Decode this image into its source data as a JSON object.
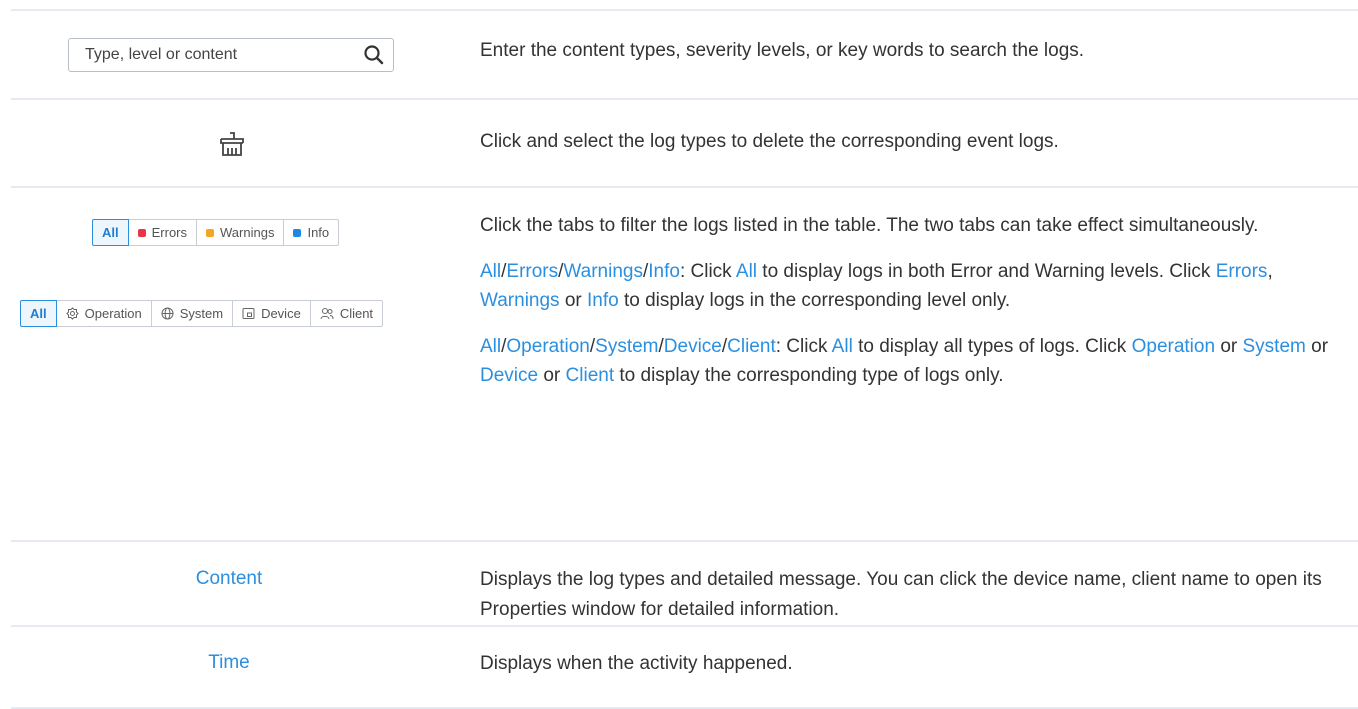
{
  "search": {
    "placeholder": "Type, level or content",
    "description": "Enter the content types, severity levels, or key words to search the logs."
  },
  "clear": {
    "description": "Click and select the log types to delete the corresponding event logs."
  },
  "level_tabs": [
    {
      "label": "All",
      "color": "#1f7fcf"
    },
    {
      "label": "Errors",
      "color": "#e8334a"
    },
    {
      "label": "Warnings",
      "color": "#f5a623"
    },
    {
      "label": "Info",
      "color": "#1e88e5"
    }
  ],
  "type_tabs": [
    {
      "label": "All",
      "icon": "none"
    },
    {
      "label": "Operation",
      "icon": "operation-icon"
    },
    {
      "label": "System",
      "icon": "system-icon"
    },
    {
      "label": "Device",
      "icon": "device-icon"
    },
    {
      "label": "Client",
      "icon": "client-icon"
    }
  ],
  "tabs_row": {
    "intro": "Click the tabs to filter the logs listed in the table. The two tabs can take effect simultaneously.",
    "levels_para": {
      "l1": "All",
      "s1": "/",
      "l2": "Errors",
      "s2": "/",
      "l3": "Warnings",
      "s3": "/",
      "l4": "Info",
      "t1": ": Click ",
      "l5": "All",
      "t2": " to display logs in both Error and Warning levels. Click ",
      "l6": "Errors",
      "t3": ", ",
      "l7": "Warnings",
      "t4": " or ",
      "l8": "Info",
      "t5": " to display logs in the corresponding level only."
    },
    "types_para": {
      "l1": "All",
      "s1": "/",
      "l2": "Operation",
      "s2": "/",
      "l3": "System",
      "s3": "/",
      "l4": "Device",
      "s4": "/",
      "l5": "Client",
      "t1": ": Click ",
      "l6": "All",
      "t2": " to display all types of logs. Click ",
      "l7": "Operation",
      "t3": " or ",
      "l8": "System",
      "t4": " or ",
      "l9": "Device",
      "t5": " or ",
      "l10": "Client",
      "t6": " to display the corresponding type of logs only."
    }
  },
  "content_row": {
    "label": "Content",
    "description": "Displays the log types and detailed message. You can click the device name, client name to open its Properties window for detailed information."
  },
  "time_row": {
    "label": "Time",
    "description": "Displays when the activity happened."
  }
}
